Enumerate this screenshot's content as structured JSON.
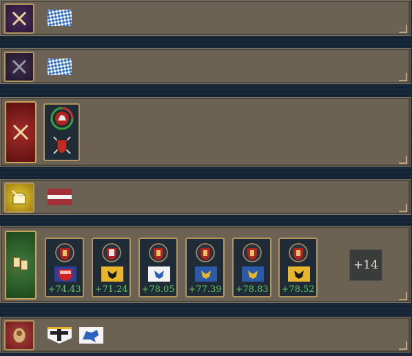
{
  "rows": [
    {
      "icon": "crossed-swords-icon",
      "flags": [
        "bavaria-flag"
      ]
    },
    {
      "icon": "crossed-swords-icon",
      "flags": [
        "bavaria-flag"
      ]
    },
    {
      "icon": "crossed-swords-icon",
      "participants": [
        "lithuania-coat-of-arms",
        "shield-and-swords-icon"
      ]
    },
    {
      "icon": "treasure-chest-icon",
      "flags": [
        "latvia-style-flag"
      ]
    },
    {
      "icon": "banners-icon",
      "cards": [
        {
          "value": "+74.43"
        },
        {
          "value": "+71.24"
        },
        {
          "value": "+78.05"
        },
        {
          "value": "+77.39"
        },
        {
          "value": "+78.83"
        },
        {
          "value": "+78.52"
        }
      ],
      "more": "+14"
    },
    {
      "icon": "portrait-icon",
      "flags": [
        "cross-pennant-flag",
        "blue-lion-flag"
      ]
    }
  ],
  "colors": {
    "positive": "#63c95d",
    "panel": "#6b6253",
    "gold_border": "#b39560"
  }
}
